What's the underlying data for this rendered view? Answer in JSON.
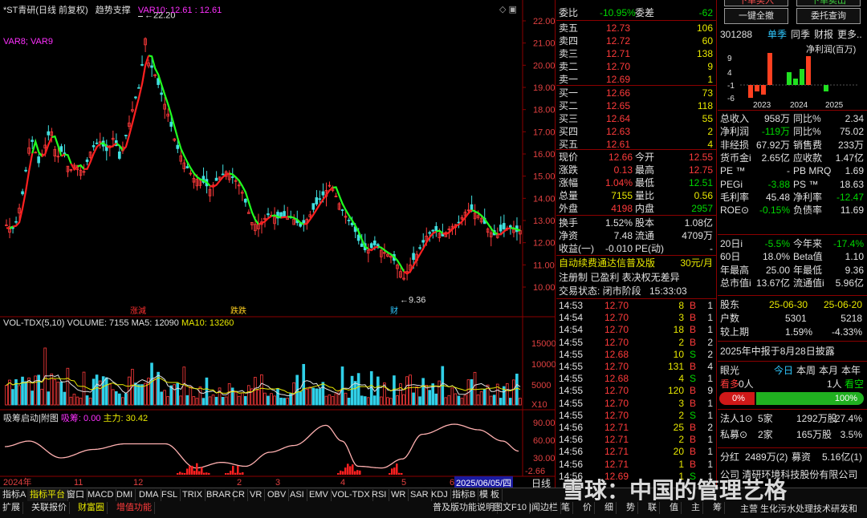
{
  "chart_header": {
    "name": "*ST青研(日线 前复权)",
    "indicator": "趋势支撑",
    "var10_label": "VAR10: 12.61 : 12.61",
    "max_label": "22.20",
    "min_label": "9.36",
    "var_legend": "VAR8; VAR9"
  },
  "price_axis": [
    "22.00",
    "21.00",
    "20.00",
    "19.00",
    "18.00",
    "17.00",
    "16.00",
    "15.00",
    "14.00",
    "13.00",
    "12.00",
    "11.00",
    "10.00"
  ],
  "markers": [
    "涨減",
    "跌跌",
    "财"
  ],
  "vol_header": {
    "name": "VOL-TDX(5,10)",
    "volume": "VOLUME: 7155",
    "ma5": "MA5: 12090",
    "ma10": "MA10: 13260"
  },
  "vol_axis": [
    "15000",
    "10000",
    "5000",
    "X10"
  ],
  "ind_header": {
    "name": "吸筹启动|附图",
    "a": "吸筹: 0.00",
    "b": "主力: 30.42"
  },
  "ind_axis": [
    "90.00",
    "60.00",
    "30.00",
    "-2.66"
  ],
  "date_axis": [
    "2024年",
    "11",
    "12",
    "2",
    "3",
    "4",
    "5",
    "6"
  ],
  "current_date": "2025/06/05/四",
  "period": "日线",
  "quote": {
    "weibi": {
      "l1": "委比",
      "v1": "-10.95%",
      "l2": "委差",
      "v2": "-62"
    },
    "sells": [
      {
        "l": "卖五",
        "p": "12.73",
        "v": "106"
      },
      {
        "l": "卖四",
        "p": "12.72",
        "v": "60"
      },
      {
        "l": "卖三",
        "p": "12.71",
        "v": "138"
      },
      {
        "l": "卖二",
        "p": "12.70",
        "v": "9"
      },
      {
        "l": "卖一",
        "p": "12.69",
        "v": "1"
      }
    ],
    "buys": [
      {
        "l": "买一",
        "p": "12.66",
        "v": "73"
      },
      {
        "l": "买二",
        "p": "12.65",
        "v": "118"
      },
      {
        "l": "买三",
        "p": "12.64",
        "v": "55"
      },
      {
        "l": "买四",
        "p": "12.63",
        "v": "2"
      },
      {
        "l": "买五",
        "p": "12.61",
        "v": "4"
      }
    ],
    "stats": [
      {
        "l1": "现价",
        "v1": "12.66",
        "l2": "今开",
        "v2": "12.55"
      },
      {
        "l1": "涨跌",
        "v1": "0.13",
        "l2": "最高",
        "v2": "12.75"
      },
      {
        "l1": "涨幅",
        "v1": "1.04%",
        "l2": "最低",
        "v2": "12.51"
      },
      {
        "l1": "总量",
        "v1": "7155",
        "l2": "量比",
        "v2": "0.56"
      },
      {
        "l1": "外盘",
        "v1": "4198",
        "l2": "内盘",
        "v2": "2957"
      }
    ],
    "stats2": [
      {
        "l1": "换手",
        "v1": "1.52%",
        "l2": "股本",
        "v2": "1.08亿"
      },
      {
        "l1": "净资",
        "v1": "7.48",
        "l2": "流通",
        "v2": "4709万"
      },
      {
        "l1": "收益(一)",
        "v1": "-0.010",
        "l2": "PE(动)",
        "v2": "-"
      }
    ],
    "promo": "自动续费通达信普及版",
    "promo_price": "30元/月",
    "tags": "注册制 已盈利 表决权无差异",
    "trade_status": "交易状态: 闭市阶段",
    "trade_time": "15:33:03",
    "ticks": [
      [
        "14:53",
        "12.70",
        "8",
        "B",
        "1"
      ],
      [
        "14:54",
        "12.70",
        "3",
        "B",
        "1"
      ],
      [
        "14:54",
        "12.70",
        "18",
        "B",
        "1"
      ],
      [
        "14:55",
        "12.70",
        "2",
        "B",
        "2"
      ],
      [
        "14:55",
        "12.68",
        "10",
        "S",
        "2"
      ],
      [
        "14:55",
        "12.70",
        "131",
        "B",
        "4"
      ],
      [
        "14:55",
        "12.68",
        "4",
        "S",
        "1"
      ],
      [
        "14:55",
        "12.70",
        "120",
        "B",
        "9"
      ],
      [
        "14:55",
        "12.70",
        "3",
        "B",
        "1"
      ],
      [
        "14:55",
        "12.70",
        "2",
        "S",
        "1"
      ],
      [
        "14:56",
        "12.71",
        "25",
        "B",
        "2"
      ],
      [
        "14:56",
        "12.71",
        "2",
        "B",
        "1"
      ],
      [
        "14:56",
        "12.71",
        "20",
        "B",
        "1"
      ],
      [
        "14:56",
        "12.71",
        "1",
        "B",
        "1"
      ],
      [
        "14:56",
        "12.69",
        "1",
        "S",
        "1"
      ]
    ]
  },
  "fin": {
    "btns": [
      "一键全撤",
      "委托查询"
    ],
    "top_btns": [
      "下单买入",
      "下单卖出"
    ],
    "code": "301288",
    "tabs": [
      "单季",
      "同季",
      "财报",
      "更多.."
    ],
    "chart_title": "净利润(百万)",
    "chart_yaxis": [
      "9",
      "4",
      "-1",
      "-6"
    ],
    "chart_years": [
      "2023",
      "2024",
      "2025"
    ],
    "rows": [
      {
        "l1": "总收入",
        "v1": "958万",
        "l2": "同比%",
        "v2": "2.34"
      },
      {
        "l1": "净利润",
        "v1": "-119万",
        "l2": "同比%",
        "v2": "75.02"
      },
      {
        "l1": "非经损",
        "v1": "67.92万",
        "l2": "销售费",
        "v2": "233万"
      },
      {
        "l1": "货币金i",
        "v1": "2.65亿",
        "l2": "应收款",
        "v2": "1.47亿"
      },
      {
        "l1": "PE ™",
        "v1": "-",
        "l2": "PB MRQ",
        "v2": "1.69"
      },
      {
        "l1": "PEGi",
        "v1": "-3.88",
        "l2": "PS ™",
        "v2": "18.63"
      },
      {
        "l1": "毛利率",
        "v1": "45.48",
        "l2": "净利率",
        "v2": "-12.47"
      },
      {
        "l1": "ROE⊙",
        "v1": "-0.15%",
        "l2": "负债率",
        "v2": "11.69"
      },
      {
        "l1": "20日i",
        "v1": "-5.5%",
        "l2": "今年来",
        "v2": "-17.4%"
      },
      {
        "l1": "60日",
        "v1": "18.0%",
        "l2": "Beta值",
        "v2": "1.10"
      },
      {
        "l1": "年最高",
        "v1": "25.00",
        "l2": "年最低",
        "v2": "9.36"
      },
      {
        "l1": "总市值i",
        "v1": "13.67亿",
        "l2": "流通值i",
        "v2": "5.96亿"
      }
    ],
    "holders": {
      "title": "股东",
      "d1": "25-06-30",
      "d2": "25-06-20",
      "r1": [
        "户数",
        "5301",
        "5218"
      ],
      "r2": [
        "较上期",
        "1.59%",
        "-4.33%"
      ]
    },
    "notice": "2025年中报于8月28日披露",
    "eye": {
      "title": "眼光",
      "tabs": [
        "今日",
        "本周",
        "本月",
        "本年"
      ],
      "l": "看多",
      "lv": "0人",
      "r": "1人",
      "rv": "看空",
      "pct_l": "0%",
      "pct_r": "100%"
    },
    "holders2": [
      {
        "l": "法人1⊙",
        "a": "5家",
        "b": "1292万股",
        "c": "27.4%"
      },
      {
        "l": "私募⊙",
        "a": "2家",
        "b": "165万股",
        "c": "3.5%"
      }
    ],
    "fenhong": {
      "l": "分红",
      "a": "2489万(2)",
      "b": "募资",
      "c": "5.16亿(1)"
    },
    "company": "公司 清研环境科技股份有限公司",
    "business": "主营 生化污水处理技术研发和"
  },
  "bottom_tabs": [
    "指标A",
    "指标平台",
    "窗口",
    "MACD",
    "DMI",
    "DMA",
    "FSL",
    "TRIX",
    "BRAR",
    "CR",
    "VR",
    "OBV",
    "ASI",
    "EMV",
    "VOL-TDX",
    "RSI",
    "WR",
    "SAR",
    "KDJ",
    "指标B",
    "模 板"
  ],
  "bottom_tabs2": [
    "扩展",
    "关联报价",
    "财富圈",
    "增值功能"
  ],
  "bottom_tabs_right": [
    "普及版功能说明",
    "图文F10",
    "|闻边栏"
  ],
  "bottom_right_tabs": [
    "笔",
    "价",
    "细",
    "势",
    "联",
    "值",
    "主",
    "筹"
  ],
  "watermark": "雪球：中国的管理艺格"
}
